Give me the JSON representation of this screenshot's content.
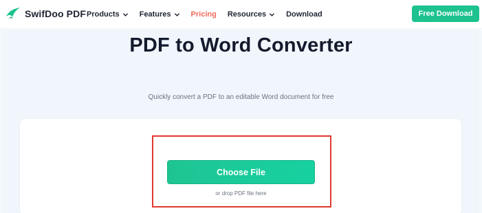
{
  "header": {
    "brand": "SwifDoo PDF",
    "nav": [
      {
        "label": "Products",
        "has_dropdown": true,
        "active": false
      },
      {
        "label": "Features",
        "has_dropdown": true,
        "active": false
      },
      {
        "label": "Pricing",
        "has_dropdown": false,
        "active": true
      },
      {
        "label": "Resources",
        "has_dropdown": true,
        "active": false
      },
      {
        "label": "Download",
        "has_dropdown": false,
        "active": false
      }
    ],
    "cta_label": "Free Download"
  },
  "hero": {
    "title": "PDF to Word Converter",
    "subtitle": "Quickly convert a PDF to an editable Word document for free"
  },
  "upload": {
    "button_label": "Choose File",
    "drop_hint": "or drop PDF file here"
  },
  "colors": {
    "brand_green": "#1dc28f",
    "active_nav": "#f06a5c",
    "highlight_border": "#e03a2f",
    "hero_bg": "#f0f6fb"
  }
}
